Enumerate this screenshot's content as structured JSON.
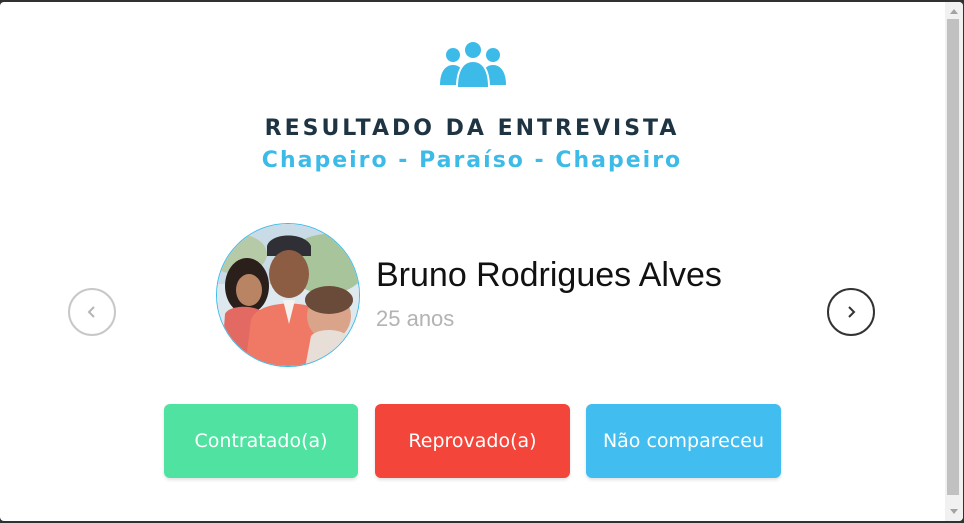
{
  "header": {
    "icon": "group-icon",
    "title": "RESULTADO DA ENTREVISTA",
    "subtitle": "Chapeiro - Paraíso - Chapeiro"
  },
  "candidate": {
    "name": "Bruno Rodrigues Alves",
    "age": "25 anos",
    "photo": "avatar-photo"
  },
  "navigation": {
    "prev_icon": "chevron-left-icon",
    "next_icon": "chevron-right-icon"
  },
  "actions": {
    "hired_label": "Contratado(a)",
    "rejected_label": "Reprovado(a)",
    "no_show_label": "Não compareceu"
  },
  "colors": {
    "title": "#1e3443",
    "accent": "#3dbbe8",
    "hired": "#4fe2a0",
    "rejected": "#f3453a",
    "no_show": "#41bdf0"
  }
}
